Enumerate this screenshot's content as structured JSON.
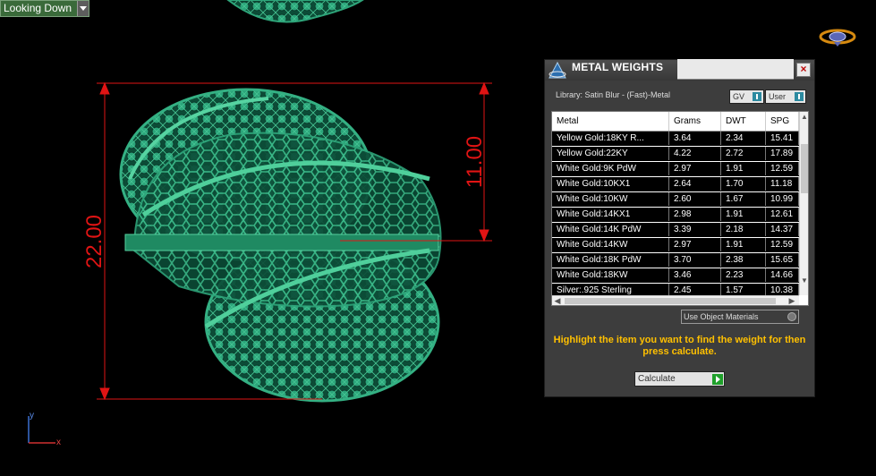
{
  "viewport": {
    "view_label": "Looking Down",
    "dimension_total": "22.00",
    "dimension_partial": "11.00",
    "axis_y": "y",
    "axis_x": "x",
    "colors": {
      "model": "#1e8a62",
      "dimension": "#e01414",
      "background": "#000000"
    }
  },
  "panel": {
    "title": "METAL WEIGHTS",
    "close_label": "×",
    "library_label": "Library: Satin Blur - (Fast)-Metal",
    "gv_label": "GV",
    "user_label": "User",
    "columns": [
      "Metal",
      "Grams",
      "DWT",
      "SPG"
    ],
    "rows": [
      [
        "Yellow Gold:18KY R...",
        "3.64",
        "2.34",
        "15.41"
      ],
      [
        "Yellow Gold:22KY",
        "4.22",
        "2.72",
        "17.89"
      ],
      [
        "White Gold:9K PdW",
        "2.97",
        "1.91",
        "12.59"
      ],
      [
        "White Gold:10KX1",
        "2.64",
        "1.70",
        "11.18"
      ],
      [
        "White Gold:10KW",
        "2.60",
        "1.67",
        "10.99"
      ],
      [
        "White Gold:14KX1",
        "2.98",
        "1.91",
        "12.61"
      ],
      [
        "White Gold:14K PdW",
        "3.39",
        "2.18",
        "14.37"
      ],
      [
        "White Gold:14KW",
        "2.97",
        "1.91",
        "12.59"
      ],
      [
        "White Gold:18K PdW",
        "3.70",
        "2.38",
        "15.65"
      ],
      [
        "White Gold:18KW",
        "3.46",
        "2.23",
        "14.66"
      ],
      [
        "Silver:.925 Sterling",
        "2.45",
        "1.57",
        "10.38"
      ]
    ],
    "use_object_materials_label": "Use Object Materials",
    "instruction": "Highlight the item you want to find the weight for then press calculate.",
    "calculate_label": "Calculate",
    "colors": {
      "instruction": "#ffc000",
      "accent": "#2c8aa0",
      "go": "#1fa02a"
    }
  }
}
